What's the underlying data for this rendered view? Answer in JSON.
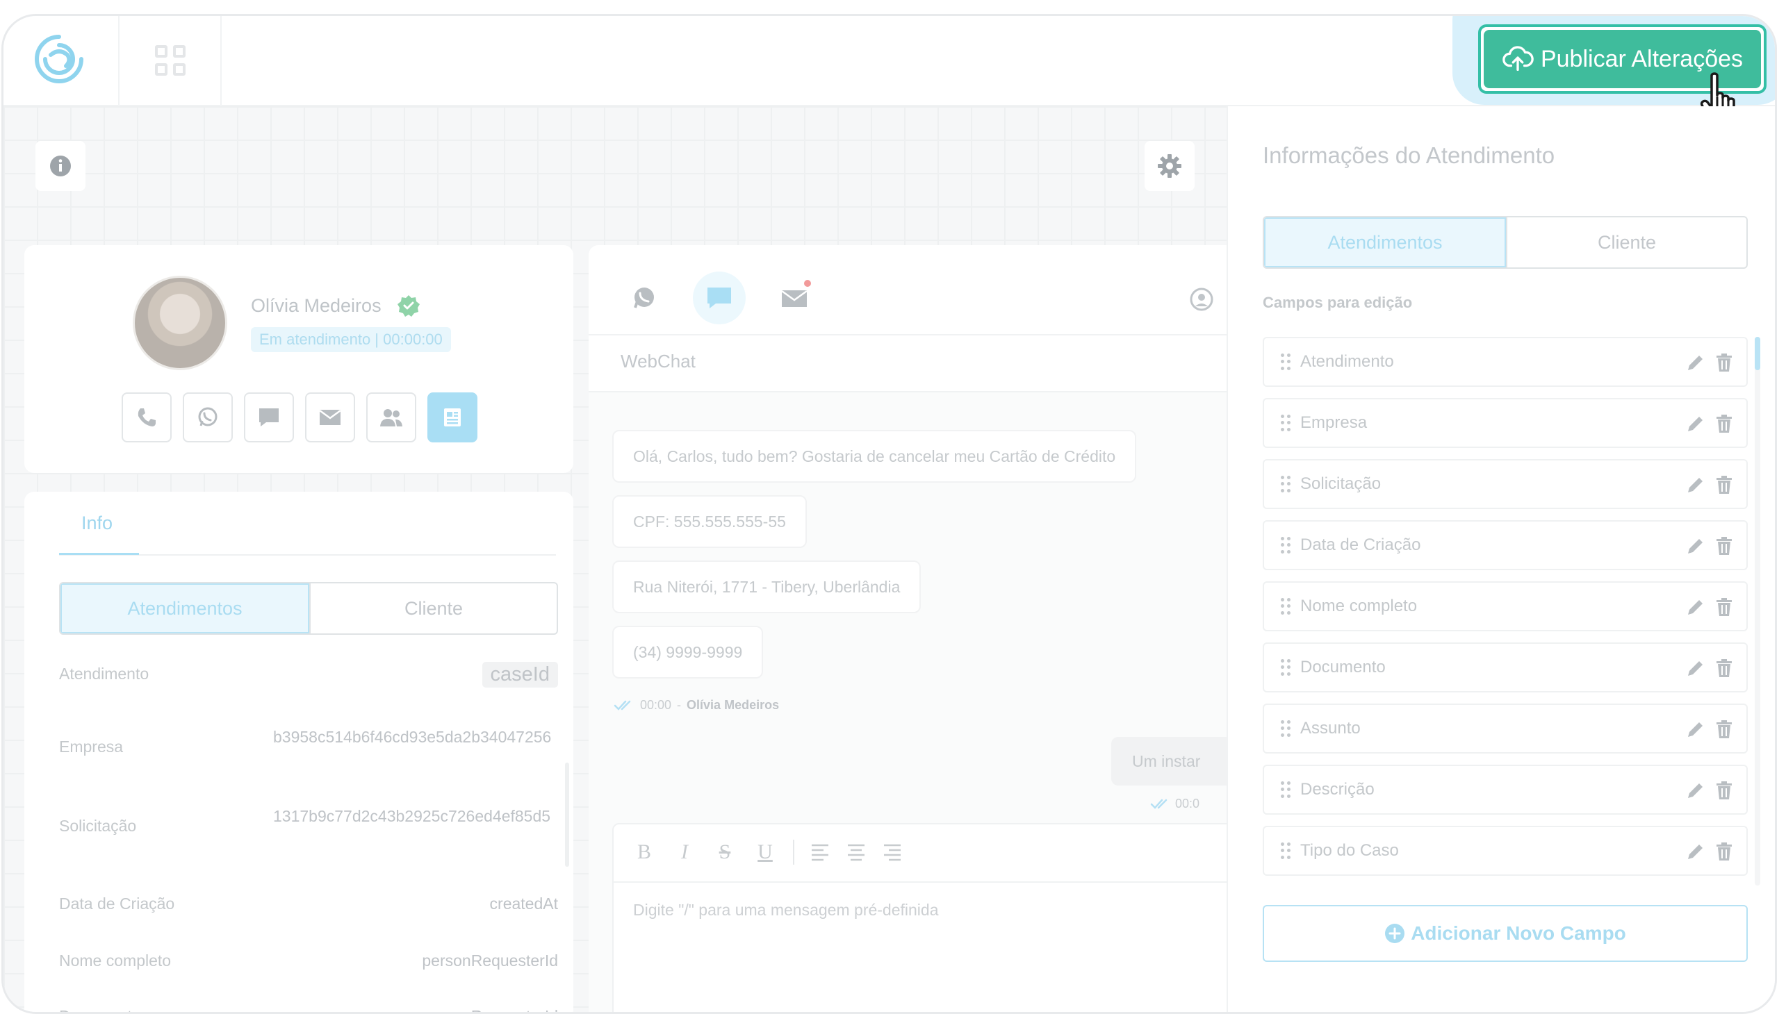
{
  "topbar": {
    "publish_label": "Publicar Alterações"
  },
  "profile": {
    "name": "Olívia Medeiros",
    "status": "Em atendimento | 00:00:00",
    "channel_buttons": [
      "phone-icon",
      "whatsapp-icon",
      "chat-icon",
      "mail-icon",
      "users-icon",
      "document-icon"
    ]
  },
  "details": {
    "tab_label": "Info",
    "segments": [
      "Atendimentos",
      "Cliente"
    ],
    "rows": [
      {
        "label": "Atendimento",
        "value": "caseId"
      },
      {
        "label": "Empresa",
        "value": "b3958c514b6f46cd93e5da2b34047256"
      },
      {
        "label": "Solicitação",
        "value": "1317b9c77d2c43b2925c726ed4ef85d5"
      },
      {
        "label": "Data de Criação",
        "value": "createdAt"
      },
      {
        "label": "Nome completo",
        "value": "personRequesterId"
      },
      {
        "label": "Documento",
        "value": "personRequesterId"
      }
    ]
  },
  "chat": {
    "channel_name": "WebChat",
    "messages": [
      "Olá, Carlos, tudo bem? Gostaria de cancelar meu Cartão de Crédito",
      "CPF: 555.555.555-55",
      "Rua Niterói, 1771 - Tibery, Uberlândia",
      "(34) 9999-9999"
    ],
    "meta_time": "00:00",
    "meta_sep": "-",
    "meta_sender": "Olívia Medeiros",
    "outgoing_text": "Um instar",
    "outgoing_time": "00:0",
    "editor_placeholder": "Digite \"/\" para uma mensagem pré-definida",
    "toolbar": [
      "B",
      "I",
      "S",
      "U"
    ]
  },
  "panel": {
    "title": "Informações do Atendimento",
    "segments": [
      "Atendimentos",
      "Cliente"
    ],
    "section_label": "Campos para edição",
    "fields": [
      "Atendimento",
      "Empresa",
      "Solicitação",
      "Data de Criação",
      "Nome completo",
      "Documento",
      "Assunto",
      "Descrição",
      "Tipo do Caso"
    ],
    "add_label": "Adicionar Novo Campo"
  },
  "colors": {
    "accent_green": "#3fbc9c",
    "accent_blue": "#a9def4"
  }
}
